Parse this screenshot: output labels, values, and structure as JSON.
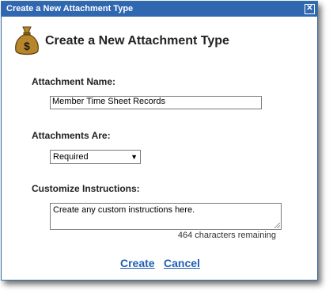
{
  "window": {
    "title": "Create a New Attachment Type",
    "close_icon": "close-icon"
  },
  "header": {
    "title": "Create a New Attachment Type",
    "icon": "money-bag-icon",
    "icon_symbol": "$"
  },
  "fields": {
    "name_label": "Attachment Name:",
    "name_value": "Member Time Sheet Records",
    "are_label": "Attachments Are:",
    "are_selected": "Required",
    "instructions_label": "Customize Instructions:",
    "instructions_value": "Create any custom instructions here.",
    "chars_remaining": "464 characters remaining"
  },
  "actions": {
    "create_label": "Create",
    "cancel_label": "Cancel"
  },
  "colors": {
    "titlebar": "#2f67b1",
    "link": "#1f5fb4",
    "bag": "#b8862a"
  }
}
